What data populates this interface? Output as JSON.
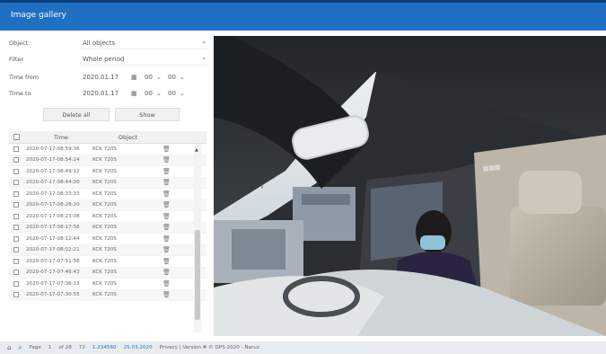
{
  "window": {
    "title": "Image gallery"
  },
  "filters": {
    "object": {
      "label": "Object:",
      "value": "All objects"
    },
    "filter": {
      "label": "Filter",
      "value": "Whole period"
    },
    "time_from": {
      "label": "Time from",
      "date": "2020.01.17",
      "hour": "00",
      "minute": "00"
    },
    "time_to": {
      "label": "Time to",
      "date": "2020.01.17",
      "hour": "00",
      "minute": "00"
    }
  },
  "actions": {
    "delete_all": "Delete all",
    "show": "Show"
  },
  "table": {
    "columns": {
      "time": "Time",
      "object": "Object"
    },
    "rows": [
      {
        "time": "2020-07-17-08:59:36",
        "object": "KCK 720S"
      },
      {
        "time": "2020-07-17-08:54:24",
        "object": "KCK 720S"
      },
      {
        "time": "2020-07-17-08:49:12",
        "object": "KCK 720S"
      },
      {
        "time": "2020-07-17-08:44:00",
        "object": "KCK 720S"
      },
      {
        "time": "2020-07-17-08:33:33",
        "object": "KCK 720S"
      },
      {
        "time": "2020-07-17-08:28:20",
        "object": "KCK 720S"
      },
      {
        "time": "2020-07-17-08:23:08",
        "object": "KCK 720S"
      },
      {
        "time": "2020-07-17-08:17:56",
        "object": "KCK 720S"
      },
      {
        "time": "2020-07-17-08:12:44",
        "object": "KCK 720S"
      },
      {
        "time": "2020-07-17-08:02:21",
        "object": "KCK 720S"
      },
      {
        "time": "2020-07-17-07:51:56",
        "object": "KCK 720S"
      },
      {
        "time": "2020-07-17-07:46:43",
        "object": "KCK 720S"
      },
      {
        "time": "2020-07-17-07:36:13",
        "object": "KCK 720S"
      },
      {
        "time": "2020-07-17-07:30:55",
        "object": "KCK 720S"
      }
    ]
  },
  "status": {
    "page_label": "Page",
    "page": "1",
    "of_pages": "of 28",
    "per_page": "72",
    "version": "1.234560",
    "build": "25.03.2020",
    "copyright": "Privacy | Version # © GPS 2020 - Naruz"
  },
  "icons": {
    "calendar": "calendar-icon",
    "chevron": "chevron-down-icon",
    "trash": "trash-icon",
    "home": "home-icon",
    "search": "search-icon"
  },
  "colors": {
    "title_bar": "#1f6fc3",
    "panel_bg": "#ffffff",
    "page_bg": "#e9ecef"
  }
}
